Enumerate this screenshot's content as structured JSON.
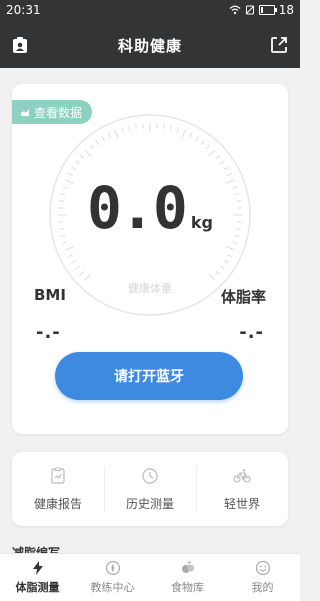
{
  "status_bar": {
    "time": "20:31",
    "battery": "18"
  },
  "header": {
    "title": "科助健康"
  },
  "main_card": {
    "chip_label": "查看数据",
    "weight_value": "0.0",
    "weight_unit": "kg",
    "weight_caption": "健康体重",
    "bmi_label": "BMI",
    "bmi_value": "-.-",
    "body_fat_label": "体脂率",
    "body_fat_value": "-.-",
    "bluetooth_button": "请打开蓝牙"
  },
  "features": [
    {
      "label": "健康报告",
      "icon": "report-icon"
    },
    {
      "label": "历史测量",
      "icon": "clock-icon"
    },
    {
      "label": "轻世界",
      "icon": "bicycle-icon"
    }
  ],
  "section_peek": "减脂编写",
  "tabs": [
    {
      "label": "体脂测量",
      "icon": "lightning-icon",
      "active": true
    },
    {
      "label": "教练中心",
      "icon": "coach-icon",
      "active": false
    },
    {
      "label": "食物库",
      "icon": "food-icon",
      "active": false
    },
    {
      "label": "我的",
      "icon": "smile-icon",
      "active": false
    }
  ],
  "colors": {
    "header_bg": "#333436",
    "accent_blue": "#3d8ae0",
    "chip_green": "#8fd1c1",
    "background": "#f1f1f1"
  }
}
